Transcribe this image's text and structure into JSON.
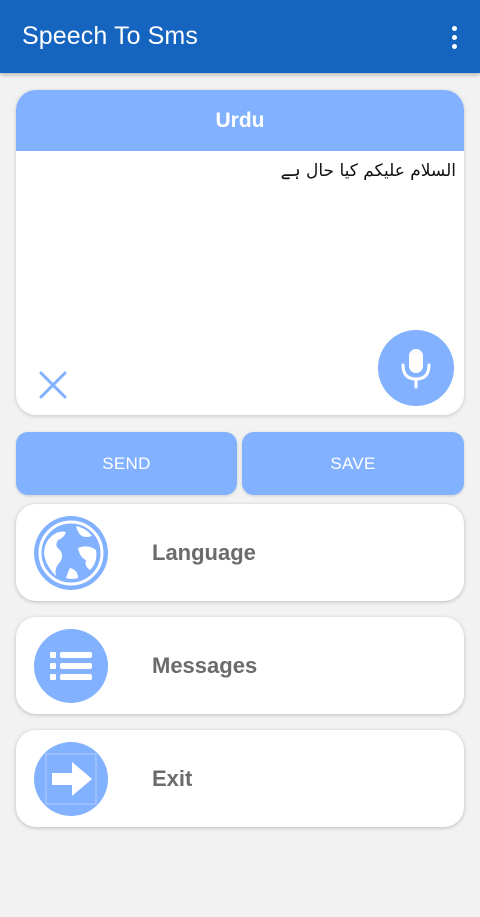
{
  "app_bar": {
    "title": "Speech To Sms",
    "overflow_icon": "more-vert-icon"
  },
  "editor": {
    "language": "Urdu",
    "text": "السلام علیکم کیا حال ہے",
    "clear_icon": "close-icon",
    "mic_icon": "microphone-icon"
  },
  "actions": {
    "send_label": "SEND",
    "save_label": "SAVE"
  },
  "menu": [
    {
      "label": "Language",
      "icon": "globe-icon"
    },
    {
      "label": "Messages",
      "icon": "list-icon"
    },
    {
      "label": "Exit",
      "icon": "arrow-right-icon"
    }
  ],
  "colors": {
    "app_bar": "#1565c0",
    "accent": "#82b1ff",
    "background": "#f2f2f2",
    "menu_text": "#6b6b6b"
  }
}
